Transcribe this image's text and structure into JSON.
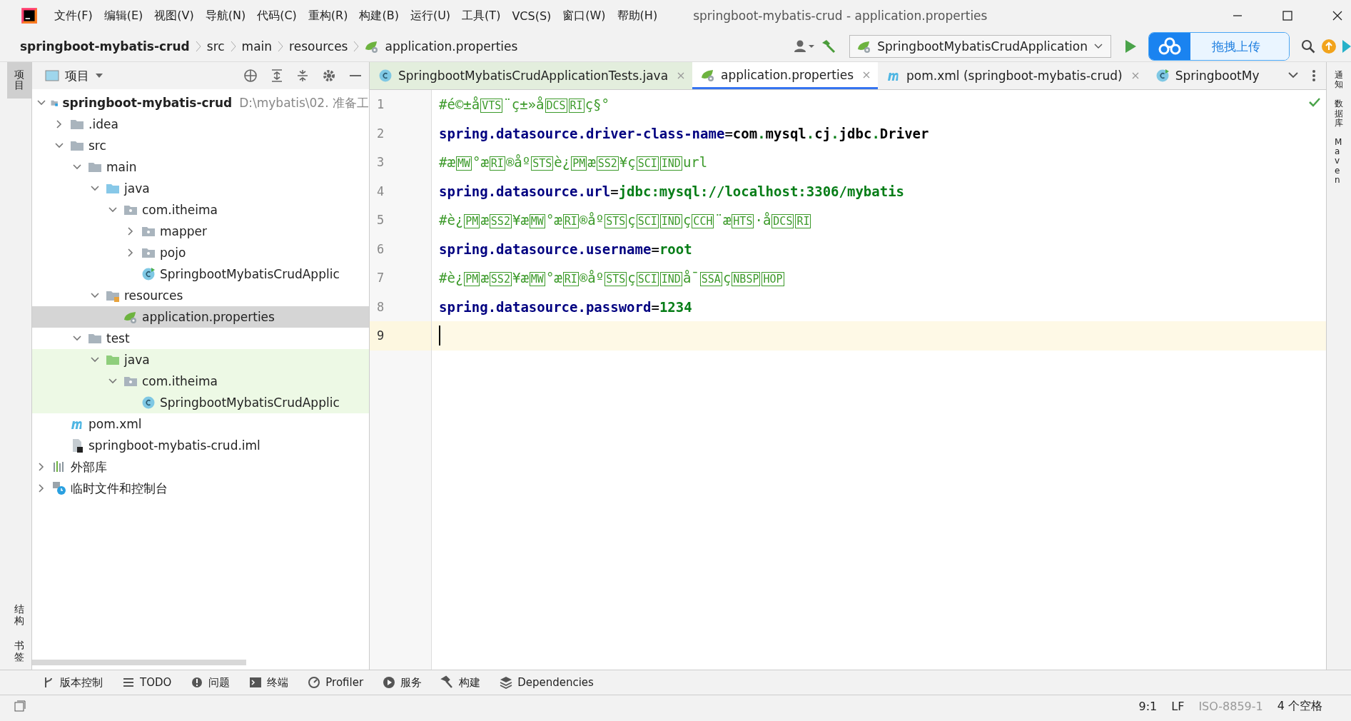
{
  "window": {
    "title": "springboot-mybatis-crud - application.properties"
  },
  "menu": [
    "文件(F)",
    "编辑(E)",
    "视图(V)",
    "导航(N)",
    "代码(C)",
    "重构(R)",
    "构建(B)",
    "运行(U)",
    "工具(T)",
    "VCS(S)",
    "窗口(W)",
    "帮助(H)"
  ],
  "breadcrumbs": [
    "springboot-mybatis-crud",
    "src",
    "main",
    "resources",
    "application.properties"
  ],
  "run_config": "SpringbootMybatisCrudApplication",
  "upload_widget": {
    "label": "拖拽上传"
  },
  "left_strip": [
    {
      "label": "项目",
      "selected": true
    },
    {
      "label": "结构",
      "selected": false
    },
    {
      "label": "书签",
      "selected": false
    }
  ],
  "right_strip": [
    "通知",
    "数据库",
    "Maven"
  ],
  "project_panel": {
    "title": "项目"
  },
  "tree": [
    {
      "label": "springboot-mybatis-crud",
      "path": "D:\\mybatis\\02. 准备工",
      "kind": "module",
      "bold": true,
      "expanded": true,
      "selected": false,
      "test": false,
      "children": [
        {
          "label": ".idea",
          "kind": "folder",
          "expanded": false,
          "selected": false,
          "test": false
        },
        {
          "label": "src",
          "kind": "folder",
          "expanded": true,
          "selected": false,
          "test": false,
          "children": [
            {
              "label": "main",
              "kind": "folder",
              "expanded": true,
              "selected": false,
              "test": false,
              "children": [
                {
                  "label": "java",
                  "kind": "source",
                  "expanded": true,
                  "selected": false,
                  "test": false,
                  "children": [
                    {
                      "label": "com.itheima",
                      "kind": "package",
                      "expanded": true,
                      "selected": false,
                      "test": false,
                      "children": [
                        {
                          "label": "mapper",
                          "kind": "package",
                          "expanded": false,
                          "selected": false,
                          "test": false
                        },
                        {
                          "label": "pojo",
                          "kind": "package",
                          "expanded": false,
                          "selected": false,
                          "test": false
                        },
                        {
                          "label": "SpringbootMybatisCrudApplic",
                          "kind": "spring-class",
                          "selected": false,
                          "test": false
                        }
                      ]
                    }
                  ]
                },
                {
                  "label": "resources",
                  "kind": "resources",
                  "expanded": true,
                  "selected": false,
                  "test": false,
                  "children": [
                    {
                      "label": "application.properties",
                      "kind": "properties",
                      "selected": true,
                      "test": false
                    }
                  ]
                }
              ]
            },
            {
              "label": "test",
              "kind": "folder",
              "expanded": true,
              "selected": false,
              "test": false,
              "children": [
                {
                  "label": "java",
                  "kind": "test-source",
                  "expanded": true,
                  "selected": false,
                  "test": true,
                  "children": [
                    {
                      "label": "com.itheima",
                      "kind": "package",
                      "expanded": true,
                      "selected": false,
                      "test": true,
                      "children": [
                        {
                          "label": "SpringbootMybatisCrudApplic",
                          "kind": "class",
                          "selected": false,
                          "test": true
                        }
                      ]
                    }
                  ]
                }
              ]
            }
          ]
        },
        {
          "label": "pom.xml",
          "kind": "maven",
          "selected": false,
          "test": false
        },
        {
          "label": "springboot-mybatis-crud.iml",
          "kind": "iml",
          "selected": false,
          "test": false
        }
      ]
    },
    {
      "label": "外部库",
      "kind": "library",
      "expanded": false,
      "selected": false,
      "test": false
    },
    {
      "label": "临时文件和控制台",
      "kind": "scratch",
      "expanded": false,
      "selected": false,
      "test": false
    }
  ],
  "tabs": [
    {
      "label": "SpringbootMybatisCrudApplicationTests.java",
      "kind": "class",
      "selected": false,
      "closable": true
    },
    {
      "label": "application.properties",
      "kind": "properties",
      "selected": true,
      "closable": true
    },
    {
      "label": "pom.xml (springboot-mybatis-crud)",
      "kind": "maven",
      "selected": false,
      "closable": true
    },
    {
      "label": "SpringbootMy",
      "kind": "spring-class",
      "selected": false,
      "closable": false
    }
  ],
  "editor": {
    "lines": [
      {
        "number": "1",
        "current": false,
        "tokens": [
          {
            "kind": "comment",
            "text": "#é©±å"
          },
          {
            "kind": "ctrl",
            "text": "VTS"
          },
          {
            "kind": "comment",
            "text": "¨ç±»å"
          },
          {
            "kind": "ctrl",
            "text": "DCS"
          },
          {
            "kind": "ctrl",
            "text": "RI"
          },
          {
            "kind": "comment",
            "text": "ç§°"
          }
        ]
      },
      {
        "number": "2",
        "current": false,
        "tokens": [
          {
            "kind": "key",
            "text": "spring.datasource.driver-class-name"
          },
          {
            "kind": "sep",
            "text": "="
          },
          {
            "kind": "plain",
            "text": "com"
          },
          {
            "kind": "dot",
            "text": "."
          },
          {
            "kind": "plain",
            "text": "mysql"
          },
          {
            "kind": "dot",
            "text": "."
          },
          {
            "kind": "plain",
            "text": "cj"
          },
          {
            "kind": "dot",
            "text": "."
          },
          {
            "kind": "plain",
            "text": "jdbc"
          },
          {
            "kind": "dot",
            "text": "."
          },
          {
            "kind": "plain",
            "text": "Driver"
          }
        ]
      },
      {
        "number": "3",
        "current": false,
        "tokens": [
          {
            "kind": "comment",
            "text": "#æ"
          },
          {
            "kind": "ctrl",
            "text": "MW"
          },
          {
            "kind": "comment",
            "text": "°æ"
          },
          {
            "kind": "ctrl",
            "text": "RI"
          },
          {
            "kind": "comment",
            "text": "®åº"
          },
          {
            "kind": "ctrl",
            "text": "STS"
          },
          {
            "kind": "comment",
            "text": "è¿"
          },
          {
            "kind": "ctrl",
            "text": "PM"
          },
          {
            "kind": "comment",
            "text": "æ"
          },
          {
            "kind": "ctrl",
            "text": "SS2"
          },
          {
            "kind": "comment",
            "text": "¥ç"
          },
          {
            "kind": "ctrl",
            "text": "SCI"
          },
          {
            "kind": "ctrl",
            "text": "IND"
          },
          {
            "kind": "comment",
            "text": "url"
          }
        ]
      },
      {
        "number": "4",
        "current": false,
        "tokens": [
          {
            "kind": "key",
            "text": "spring.datasource.url"
          },
          {
            "kind": "sep",
            "text": "="
          },
          {
            "kind": "value",
            "text": "jdbc:mysql://localhost:3306/mybatis"
          }
        ]
      },
      {
        "number": "5",
        "current": false,
        "tokens": [
          {
            "kind": "comment",
            "text": "#è¿"
          },
          {
            "kind": "ctrl",
            "text": "PM"
          },
          {
            "kind": "comment",
            "text": "æ"
          },
          {
            "kind": "ctrl",
            "text": "SS2"
          },
          {
            "kind": "comment",
            "text": "¥æ"
          },
          {
            "kind": "ctrl",
            "text": "MW"
          },
          {
            "kind": "comment",
            "text": "°æ"
          },
          {
            "kind": "ctrl",
            "text": "RI"
          },
          {
            "kind": "comment",
            "text": "®åº"
          },
          {
            "kind": "ctrl",
            "text": "STS"
          },
          {
            "kind": "comment",
            "text": "ç"
          },
          {
            "kind": "ctrl",
            "text": "SCI"
          },
          {
            "kind": "ctrl",
            "text": "IND"
          },
          {
            "kind": "comment",
            "text": "ç"
          },
          {
            "kind": "ctrl",
            "text": "CCH"
          },
          {
            "kind": "comment",
            "text": "¨æ"
          },
          {
            "kind": "ctrl",
            "text": "HTS"
          },
          {
            "kind": "comment",
            "text": "·å"
          },
          {
            "kind": "ctrl",
            "text": "DCS"
          },
          {
            "kind": "ctrl",
            "text": "RI"
          }
        ]
      },
      {
        "number": "6",
        "current": false,
        "tokens": [
          {
            "kind": "key",
            "text": "spring.datasource.username"
          },
          {
            "kind": "sep",
            "text": "="
          },
          {
            "kind": "value",
            "text": "root"
          }
        ]
      },
      {
        "number": "7",
        "current": false,
        "tokens": [
          {
            "kind": "comment",
            "text": "#è¿"
          },
          {
            "kind": "ctrl",
            "text": "PM"
          },
          {
            "kind": "comment",
            "text": "æ"
          },
          {
            "kind": "ctrl",
            "text": "SS2"
          },
          {
            "kind": "comment",
            "text": "¥æ"
          },
          {
            "kind": "ctrl",
            "text": "MW"
          },
          {
            "kind": "comment",
            "text": "°æ"
          },
          {
            "kind": "ctrl",
            "text": "RI"
          },
          {
            "kind": "comment",
            "text": "®åº"
          },
          {
            "kind": "ctrl",
            "text": "STS"
          },
          {
            "kind": "comment",
            "text": "ç"
          },
          {
            "kind": "ctrl",
            "text": "SCI"
          },
          {
            "kind": "ctrl",
            "text": "IND"
          },
          {
            "kind": "comment",
            "text": "å¯"
          },
          {
            "kind": "ctrl",
            "text": "SSA"
          },
          {
            "kind": "comment",
            "text": "ç"
          },
          {
            "kind": "ctrl",
            "text": "NBSP"
          },
          {
            "kind": "ctrl",
            "text": "HOP"
          }
        ]
      },
      {
        "number": "8",
        "current": false,
        "tokens": [
          {
            "kind": "key",
            "text": "spring.datasource.password"
          },
          {
            "kind": "sep",
            "text": "="
          },
          {
            "kind": "value",
            "text": "1234"
          }
        ]
      },
      {
        "number": "9",
        "current": true
      }
    ]
  },
  "tool_windows": [
    {
      "label": "版本控制",
      "kind": "vcs"
    },
    {
      "label": "TODO",
      "kind": "list"
    },
    {
      "label": "问题",
      "kind": "problem"
    },
    {
      "label": "终端",
      "kind": "terminal"
    },
    {
      "label": "Profiler",
      "kind": "profiler"
    },
    {
      "label": "服务",
      "kind": "play"
    },
    {
      "label": "构建",
      "kind": "hammer"
    },
    {
      "label": "Dependencies",
      "kind": "layers"
    }
  ],
  "status_bar": [
    "9:1",
    "LF",
    "ISO-8859-1",
    "4 个空格"
  ]
}
